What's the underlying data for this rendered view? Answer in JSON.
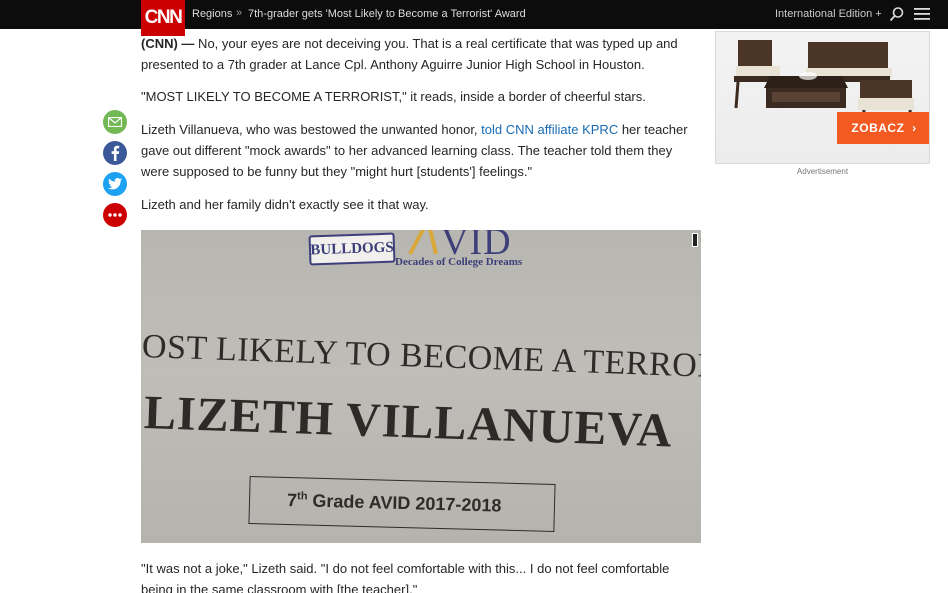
{
  "header": {
    "logo": "CNN",
    "breadcrumb_section": "Regions",
    "breadcrumb_separator": "»",
    "breadcrumb_title": "7th-grader gets 'Most Likely to Become a Terrorist' Award",
    "edition": "International Edition +",
    "icons": [
      "search-icon",
      "menu-icon"
    ]
  },
  "article": {
    "p1_dateline": "(CNN) —",
    "p1_text": " No, your eyes are not deceiving you. That is a real certificate that was typed up and presented to a 7th grader at Lance Cpl. Anthony Aguirre Junior High School in Houston.",
    "p2": "\"MOST LIKELY TO BECOME A TERRORIST,\" it reads, inside a border of cheerful stars.",
    "p3_before": "Lizeth Villanueva, who was bestowed the unwanted honor, ",
    "p3_link": "told CNN affiliate KPRC",
    "p3_after": " her teacher gave out different \"mock awards\" to her advanced learning class. The teacher told them they were supposed to be funny but they \"might hurt [students'] feelings.\"",
    "p4": "Lizeth and her family didn't exactly see it that way.",
    "p5": "\"It was not a joke,\" Lizeth said. \"I do not feel comfortable with this... I do not feel comfortable being in the same classroom with [the teacher].\""
  },
  "share": {
    "icons": [
      "email-icon",
      "facebook-icon",
      "twitter-icon",
      "more-icon"
    ],
    "colors": {
      "email": "#72b855",
      "facebook": "#3b5998",
      "twitter": "#1da1f2",
      "more": "#cc0000"
    }
  },
  "photo": {
    "logo_text": "BULLDOGS",
    "avid_text": "VID",
    "tagline": "Decades of College Dreams",
    "award_title": "OST LIKELY TO BECOME A TERRORIS",
    "award_name": "LIZETH VILLANUEVA",
    "grade_number": "7",
    "grade_suffix": "th",
    "grade_rest": " Grade AVID 2017-2018"
  },
  "ad": {
    "button_label": "ZOBACZ",
    "button_chevron": "›",
    "label": "Advertisement",
    "accent": "#f25a22"
  },
  "colors": {
    "brand": "#cc0000",
    "link": "#1a6bb5",
    "nav": "#0c0c0c"
  }
}
